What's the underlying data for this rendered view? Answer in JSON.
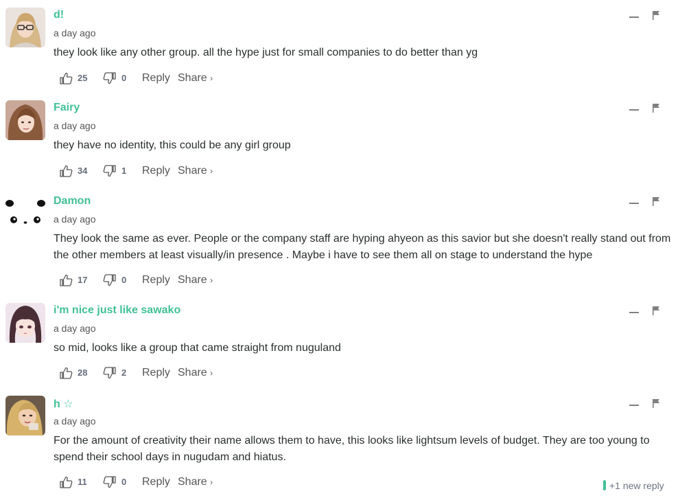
{
  "actions": {
    "reply": "Reply",
    "share": "Share",
    "share_chevron": "›"
  },
  "new_replies": "+1 new reply",
  "accent_color": "#41c096",
  "comments": [
    {
      "author": "d!",
      "time": "a day ago",
      "text": "they look like any other group. all the hype just for small companies to do better than yg",
      "likes": "25",
      "dislikes": "0",
      "avatar": "blonde-woman-with-glasses-avatar"
    },
    {
      "author": "Fairy",
      "time": "a day ago",
      "text": "they have no identity, this could be any girl group",
      "likes": "34",
      "dislikes": "1",
      "avatar": "woman-portrait-avatar"
    },
    {
      "author": "Damon",
      "time": "a day ago",
      "text": "They look the same as ever. People or the company staff are hyping ahyeon as this savior but she doesn't really stand out from the other members at least visually/in presence . Maybe i have to see them all on stage to understand the hype",
      "likes": "17",
      "dislikes": "0",
      "avatar": "panda-face-avatar"
    },
    {
      "author": "i'm nice just like sawako",
      "time": "a day ago",
      "text": "so mid, looks like a group that came straight from nuguland",
      "likes": "28",
      "dislikes": "2",
      "avatar": "anime-girl-avatar"
    },
    {
      "author": "h ☆",
      "time": "a day ago",
      "text": "For the amount of creativity their name allows them to have, this looks like lightsum levels of budget. They are too young to spend their school days in nugudam and hiatus.",
      "likes": "11",
      "dislikes": "0",
      "avatar": "woman-with-blonde-hair-avatar"
    }
  ]
}
